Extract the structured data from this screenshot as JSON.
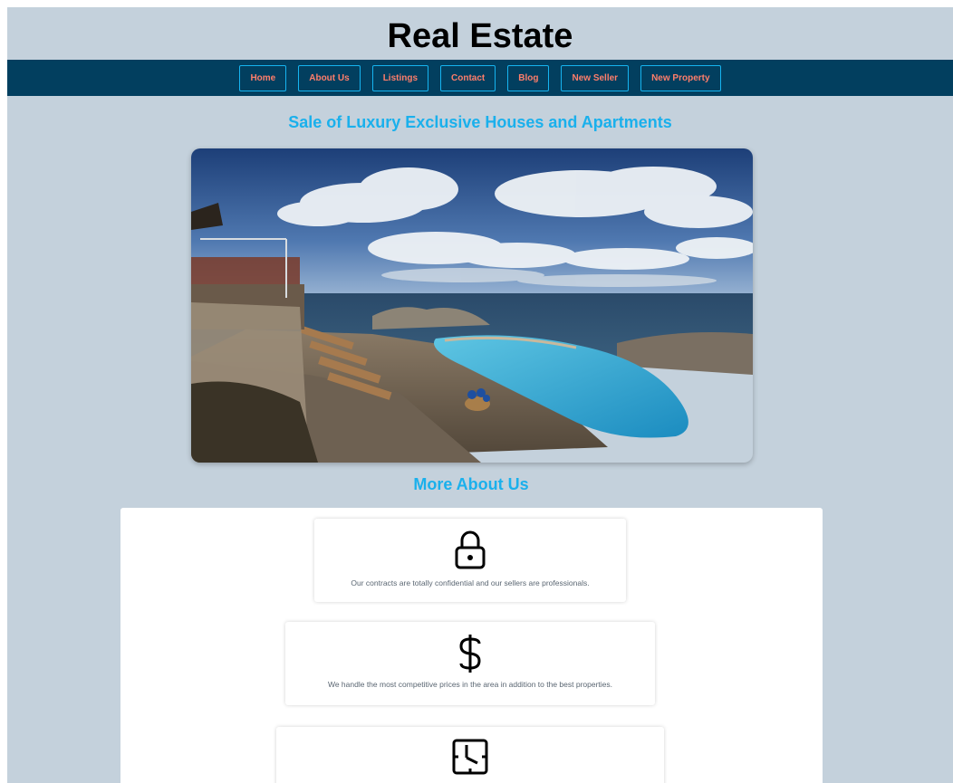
{
  "site": {
    "title": "Real Estate"
  },
  "nav": {
    "items": [
      {
        "label": "Home"
      },
      {
        "label": "About Us"
      },
      {
        "label": "Listings"
      },
      {
        "label": "Contact"
      },
      {
        "label": "Blog"
      },
      {
        "label": "New Seller"
      },
      {
        "label": "New Property"
      }
    ]
  },
  "hero": {
    "heading": "Sale of Luxury Exclusive Houses and Apartments"
  },
  "about": {
    "heading": "More About Us",
    "features": [
      {
        "icon": "lock-icon",
        "text": "Our contracts are totally confidential and our sellers are professionals."
      },
      {
        "icon": "dollar-icon",
        "text": "We handle the most competitive prices in the area in addition to the best properties."
      },
      {
        "icon": "clock-icon",
        "text": ""
      }
    ]
  },
  "colors": {
    "page_background": "#c4d1dc",
    "navbar": "#023f5f",
    "nav_text": "#ff7e6b",
    "nav_border": "#16b4f0",
    "heading_accent": "#1ab0ec"
  }
}
